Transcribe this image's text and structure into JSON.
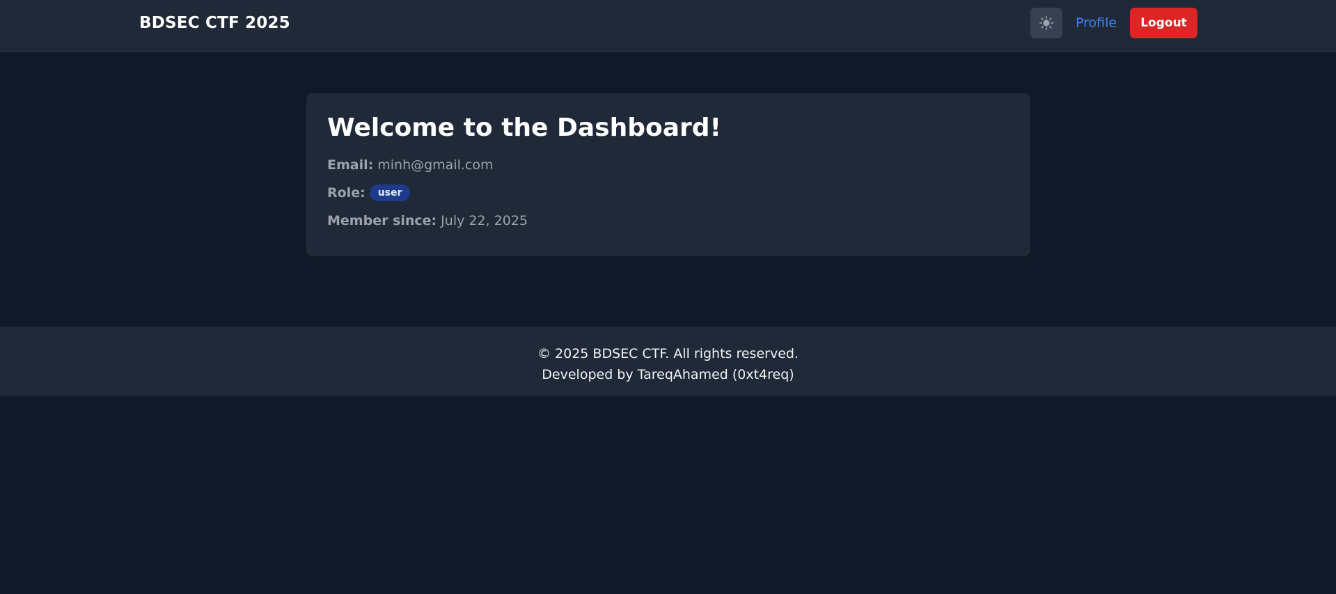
{
  "header": {
    "brand": "BDSEC CTF 2025",
    "theme_toggle_icon": "sun-icon",
    "profile_label": "Profile",
    "logout_label": "Logout"
  },
  "dashboard": {
    "title": "Welcome to the Dashboard!",
    "email_label": "Email:",
    "email_value": "minh@gmail.com",
    "role_label": "Role:",
    "role_value": "user",
    "member_since_label": "Member since:",
    "member_since_value": "July 22, 2025"
  },
  "footer": {
    "copyright": "© 2025 BDSEC CTF. All rights reserved.",
    "credit": "Developed by TareqAhamed (0xt4req)"
  },
  "colors": {
    "background": "#111827",
    "surface": "#1f2937",
    "accent_link": "#3b82f6",
    "danger": "#dc2626",
    "badge_bg": "#1e3a8a"
  }
}
